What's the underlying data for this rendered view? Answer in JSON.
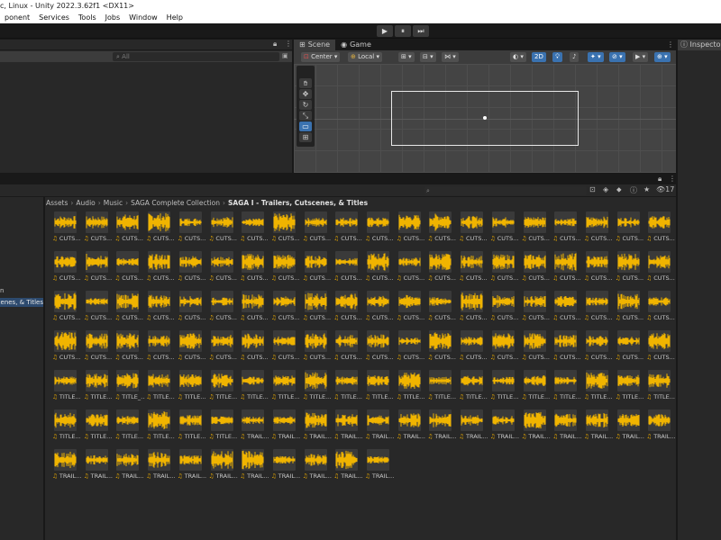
{
  "window": {
    "title": "c, Linux - Unity 2022.3.62f1 <DX11>"
  },
  "menu": [
    "ponent",
    "Services",
    "Tools",
    "Jobs",
    "Window",
    "Help"
  ],
  "play": {
    "play_icon": "▶",
    "pause_icon": "⏸",
    "step_icon": "⏭"
  },
  "hierarchy": {
    "search_placeholder": "All"
  },
  "scene": {
    "tabs": [
      {
        "label": "Scene",
        "icon": "⊞"
      },
      {
        "label": "Game",
        "icon": "◉"
      }
    ],
    "pivot": "Center",
    "space": "Local",
    "mode2d": "2D"
  },
  "inspector": {
    "tab": "Inspector"
  },
  "project": {
    "visible_count": "17",
    "breadcrumb": [
      "Assets",
      "Audio",
      "Music",
      "SAGA Complete Collection",
      "SAGA I - Trailers, Cutscenes, & Titles"
    ],
    "selected_folder": "Trailers, Cutscenes, & Titles",
    "partial_folder": "n",
    "rows": [
      {
        "label": "CUTS...",
        "count": 20
      },
      {
        "label": "CUTS...",
        "count": 20
      },
      {
        "label": "CUTS...",
        "count": 20
      },
      {
        "label": "CUTS...",
        "count": 20
      },
      {
        "labels": [
          "TITLE...",
          "TITLE...",
          "TITLE_...",
          "TITLE...",
          "TITLE...",
          "TITLE...",
          "TITLE...",
          "TITLE...",
          "TITLE...",
          "TITLE...",
          "TITLE...",
          "TITLE...",
          "TITLE...",
          "TITLE...",
          "TITLE...",
          "TITLE...",
          "TITLE...",
          "TITLE...",
          "TITLE...",
          "TITLE..."
        ]
      },
      {
        "labels": [
          "TITLE...",
          "TITLE...",
          "TITLE...",
          "TITLE...",
          "TITLE...",
          "TITLE...",
          "TRAIL...",
          "TRAIL...",
          "TRAIL...",
          "TRAIL...",
          "TRAIL...",
          "TRAIL...",
          "TRAIL...",
          "TRAIL...",
          "TRAIL...",
          "TRAIL...",
          "TRAIL...",
          "TRAIL...",
          "TRAIL...",
          "TRAIL..."
        ]
      },
      {
        "label": "TRAIL...",
        "count": 11
      }
    ]
  },
  "colors": {
    "waveform": "#f0b400",
    "note": "#e8a900",
    "accent": "#3a72b0"
  }
}
